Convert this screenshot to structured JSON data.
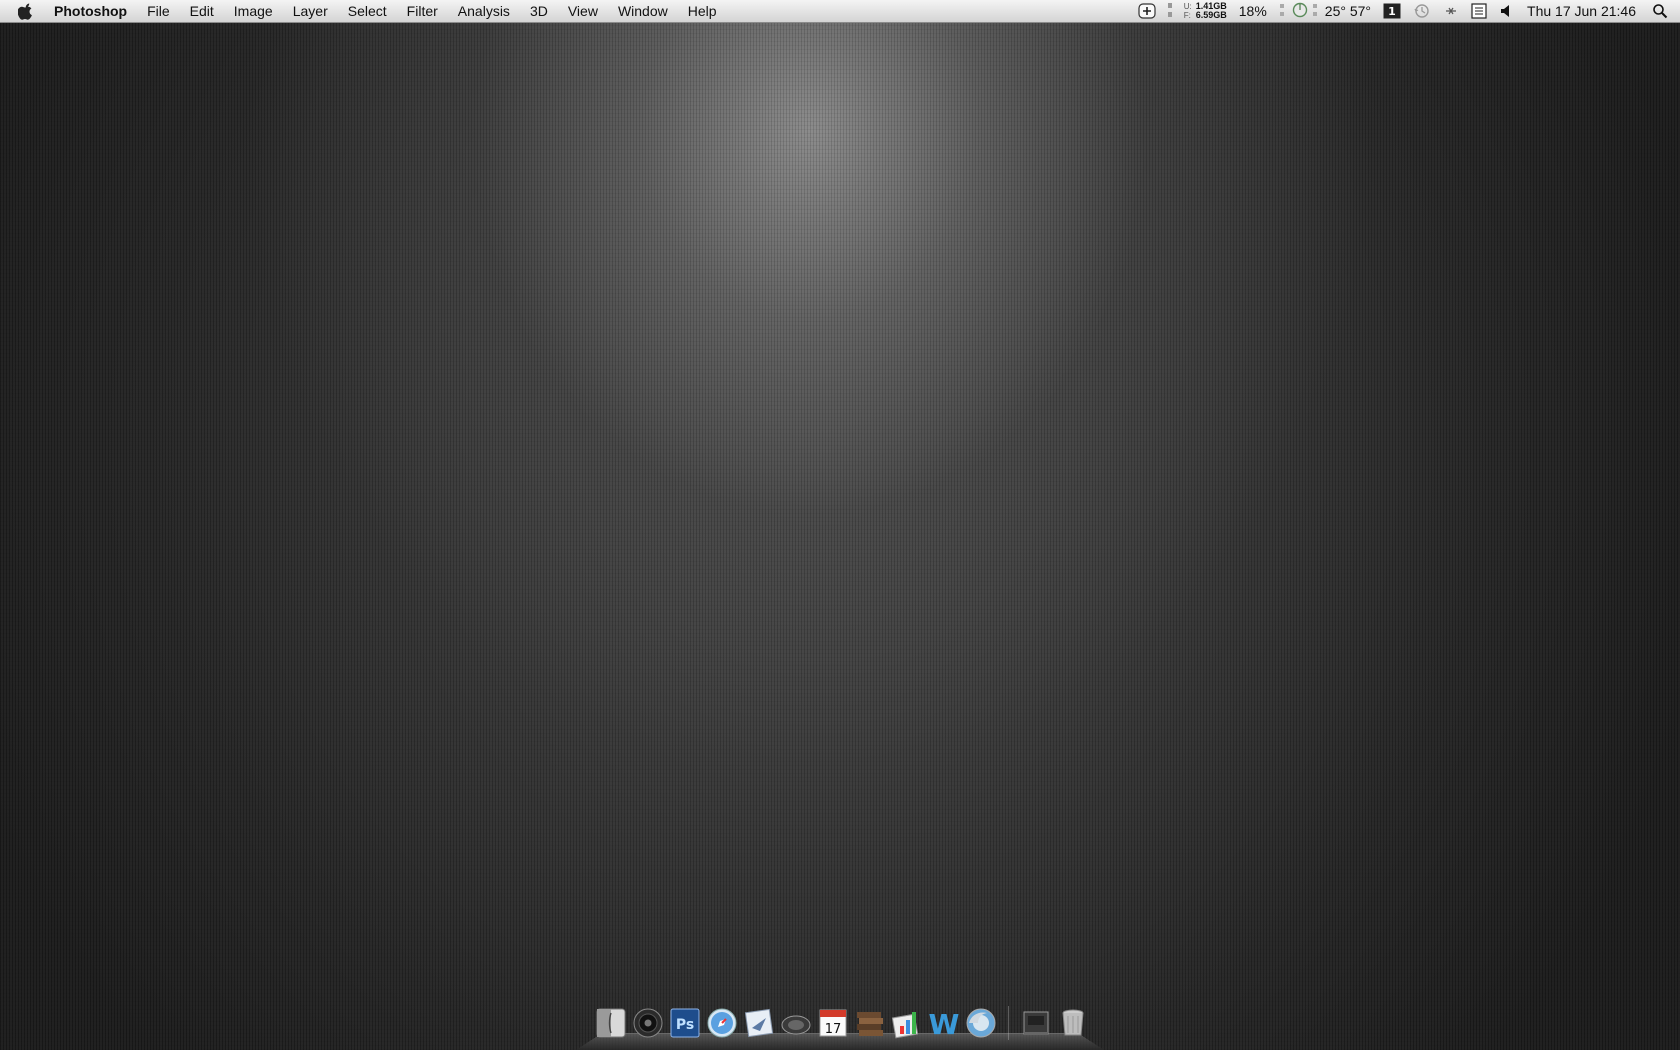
{
  "menubar": {
    "apple_icon": "apple-icon",
    "app_name": "Photoshop",
    "menus": [
      "File",
      "Edit",
      "Image",
      "Layer",
      "Select",
      "Filter",
      "Analysis",
      "3D",
      "View",
      "Window",
      "Help"
    ],
    "extras": {
      "memory": {
        "used_label": "U:",
        "free_label": "F:",
        "used": "1.41GB",
        "free": "6.59GB"
      },
      "cpu": "18%",
      "temperatures": "25° 57°",
      "datetime": "Thu 17 Jun  21:46"
    },
    "icons": [
      "add-widget-icon",
      "memory-meter-icon",
      "cpu-gauge-icon",
      "spaces-icon",
      "time-machine-icon",
      "bluetooth-icon",
      "keyboard-viewer-icon",
      "volume-icon",
      "spotlight-search-icon"
    ]
  },
  "dock": {
    "apps": [
      "finder",
      "itunes",
      "photoshop",
      "safari",
      "mail",
      "speakers",
      "ical",
      "textbook",
      "numbers",
      "word",
      "firefox"
    ],
    "others": [
      "downloads-stack",
      "trash"
    ],
    "ical_day": "17",
    "photoshop_label": "Ps",
    "word_label": "W"
  },
  "colors": {
    "menubar": "#e8e8e8",
    "desktop_highlight": "#9a9a9a",
    "desktop_dark": "#1a1a1a"
  }
}
